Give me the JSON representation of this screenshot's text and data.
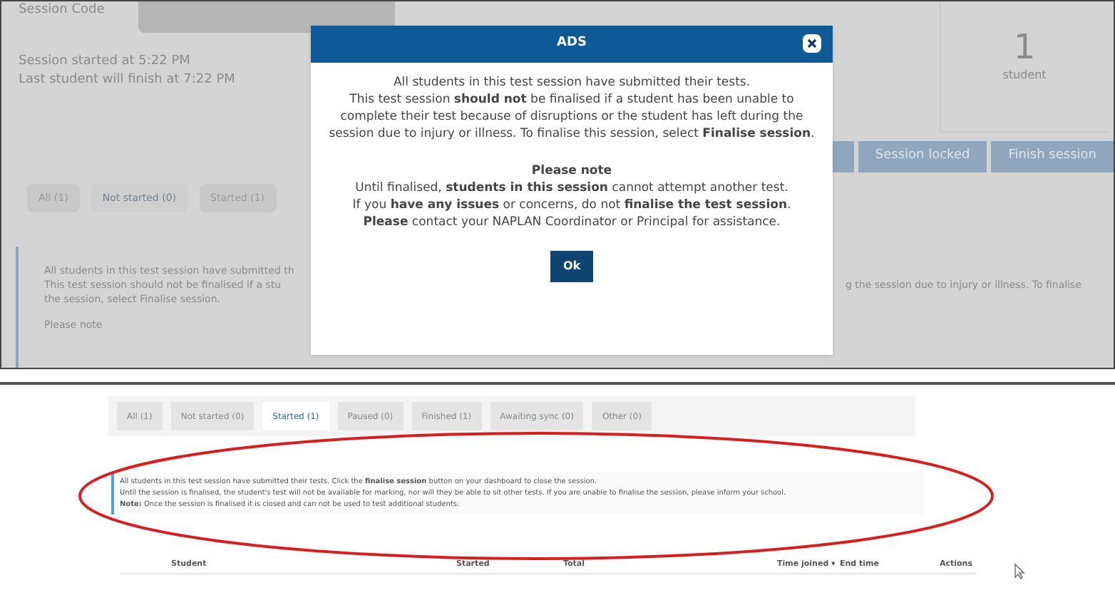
{
  "top_screen": {
    "session_code_label": "Session Code",
    "session_lines": [
      "Session started at 5:22 PM",
      "Last student will finish at 7:22 PM"
    ],
    "stat": {
      "value": "1",
      "label": "student"
    },
    "buttons": [
      "Session locked",
      "Finish session"
    ],
    "tabs": [
      {
        "label": "All (1)",
        "selected": false
      },
      {
        "label": "Not started (0)",
        "selected": true
      },
      {
        "label": "Started (1)",
        "selected": false
      }
    ],
    "info_lines": [
      "All students in this test session have submitted th",
      "This test session should not be finalised if a stu",
      "the session, select Finalise session."
    ],
    "info_right": "g the session due to injury or illness. To finalise",
    "info_note": "Please note",
    "dialog": {
      "title": "ADS",
      "paragraph": "All students in this test session have submitted their tests.\nThis test session **should not** be finalised if a student has been unable to complete their test because of disruptions or the student has left during the session due to injury or illness. To finalise this session, select **Finalise session**.",
      "note_title": "Please note",
      "note": "Until finalised, **students in this session** cannot attempt another test.\nIf you **have any issues** or concerns, do not **finalise the test session**.\n**Please** contact your NAPLAN Coordinator or Principal for assistance.",
      "button": "Ok"
    }
  },
  "bottom_screen": {
    "tabs": [
      {
        "label": "All (1)",
        "selected": false
      },
      {
        "label": "Not started (0)",
        "selected": false
      },
      {
        "label": "Started (1)",
        "selected": true
      },
      {
        "label": "Paused (0)",
        "selected": false
      },
      {
        "label": "Finished (1)",
        "selected": false
      },
      {
        "label": "Awaiting sync (0)",
        "selected": false
      },
      {
        "label": "Other (0)",
        "selected": false
      }
    ],
    "info_lines": [
      "All students in this test session have submitted their tests. Click the **finalise session** button on your dashboard to close the session.",
      "Until the session is finalised, the student's test will not be available for marking, nor will they be able to sit other tests. If you are unable to finalise the session, please inform your school.",
      "**Note:** Once the session is finalised it is closed and can not be used to test additional students."
    ],
    "columns": [
      "Student",
      "Started",
      "Total",
      "Time joined ▾",
      "End time",
      "Actions"
    ]
  }
}
